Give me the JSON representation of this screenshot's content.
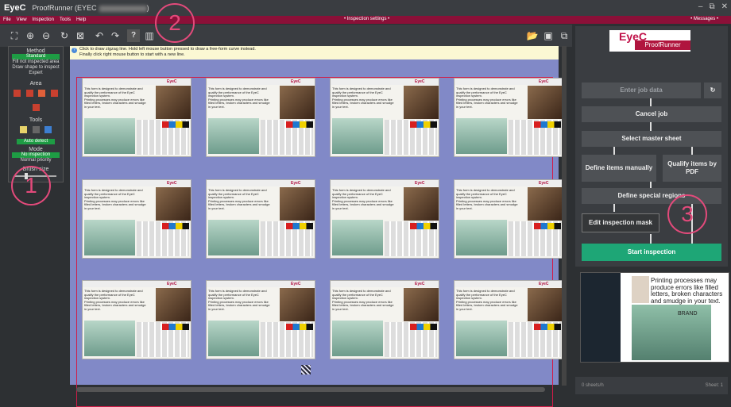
{
  "window": {
    "logo": "EyeC",
    "title": "ProofRunner (EYEC"
  },
  "menu": {
    "items": [
      "File",
      "View",
      "Inspection",
      "Tools",
      "Help"
    ],
    "center": "• Inspection settings •",
    "right": "• Messages •"
  },
  "toolbar": {
    "help": "?"
  },
  "left_panel": {
    "method_label": "Method",
    "method_options": [
      "Standard",
      "Fill not inspected area",
      "Draw shape to inspect",
      "Expert"
    ],
    "area_label": "Area",
    "tools_label": "Tools",
    "auto_detect": "Auto detect",
    "mode_label": "Mode",
    "mode_options": [
      "No inspection",
      "Normal priority"
    ],
    "brush_label": "Brush size"
  },
  "info": {
    "line1": "Click to draw zigzag line. Hold left mouse button pressed to draw a free-form curve instead.",
    "line2": "Finally click right mouse button to start with a new line."
  },
  "label": {
    "brand": "EyeC",
    "text": "This form is designed to demonstrate and qualify the performance of the EyeC inspection system.",
    "text2": "Printing processes may produce errors like filled letters, broken characters and smudge in your text."
  },
  "workflow": {
    "enter_job": "Enter job data",
    "cancel": "Cancel job",
    "select_master": "Select master sheet",
    "define_manual": "Define items manually",
    "qualify_pdf": "Qualify items by PDF",
    "special_regions": "Define special regions",
    "edit_mask": "Edit inspection mask",
    "start": "Start inspection"
  },
  "brand": {
    "logo": "EyeC",
    "name": "ProofRunner"
  },
  "preview": {
    "text": "Printing processes may produce errors like filled letters, broken characters and smudge in your text.",
    "brand": "BRAND"
  },
  "status": {
    "rate": "0 sheets/h",
    "sheet": "Sheet: 1"
  },
  "callouts": [
    "1",
    "2",
    "3"
  ],
  "colors": {
    "accent": "#8b1038",
    "green": "#1ea676",
    "callout": "#e34a7b"
  }
}
